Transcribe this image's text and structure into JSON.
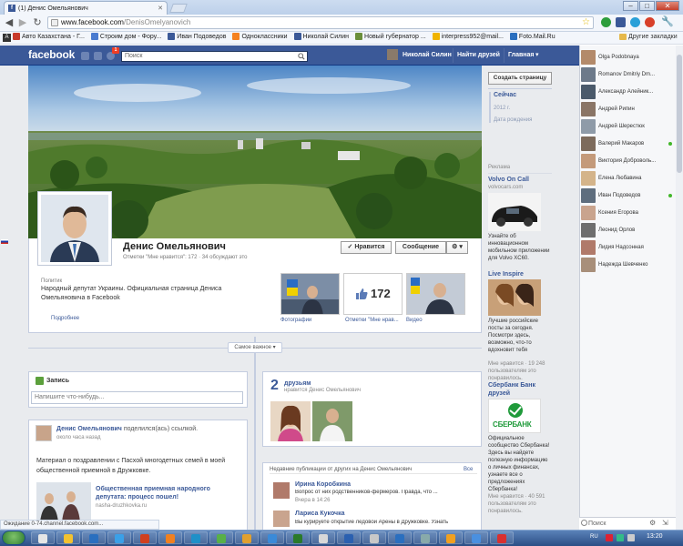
{
  "browser": {
    "tab_title": "(1) Денис Омельянович",
    "favicon_letter": "f",
    "url_host": "www.facebook.com",
    "url_path": "/DenisOmelyanovich",
    "min_label": "–",
    "max_label": "□",
    "close_label": "✕",
    "bookmarks": [
      {
        "label": "Авто Казахстана - Г...",
        "color": "#c8392b"
      },
      {
        "label": "Строим дом - Фору...",
        "color": "#4a7bd0"
      },
      {
        "label": "Иван Подоведов",
        "color": "#3b5998"
      },
      {
        "label": "Одноклассники",
        "color": "#f58220"
      },
      {
        "label": "Николай Силин",
        "color": "#3b5998"
      },
      {
        "label": "Новый губернатор ...",
        "color": "#6a8f3a"
      },
      {
        "label": "interpress952@mail...",
        "color": "#f0b400"
      },
      {
        "label": "Foto.Mail.Ru",
        "color": "#2a6fbf"
      }
    ],
    "other_bookmarks": "Другие закладки",
    "status_text": "Ожидание 0-74.channel.facebook.com..."
  },
  "fb": {
    "logo": "facebook",
    "search_placeholder": "Поиск",
    "notif_count": "1",
    "user_name": "Николай Силин",
    "nav_find_friends": "Найти друзей",
    "nav_home": "Главная",
    "name": "Денис Омельянович",
    "likes_line": "Отметки \"Мне нравится\": 172 · 34 обсуждают это",
    "like_button": "✓ Нравится",
    "message_button": "Сообщение",
    "settings_button": "⚙ ▾",
    "category": "Политик",
    "about": "Народный депутат Украины. Официальная страница Дениса Омельяновича в Facebook",
    "more_link": "Подробнее",
    "thumbs": [
      {
        "label": "Фотографии"
      },
      {
        "label": "Отметки \"Мне нрав..."
      },
      {
        "label": "Видео"
      }
    ],
    "like_count": "172",
    "create_page": "Создать страницу",
    "timeline_nav": [
      {
        "label": "Сейчас",
        "active": true
      },
      {
        "label": "2012 г.",
        "active": false
      },
      {
        "label": "Дата рождения",
        "active": false
      }
    ],
    "timeline_select": "Самое важное ▾",
    "composer_label": "Запись",
    "composer_placeholder": "Напишите что-нибудь...",
    "post": {
      "author": "Денис Омельянович",
      "action": "поделился(ась) ссылкой.",
      "time": "около часа назад",
      "text": "Материал о поздравлении с Пасхой многодетных семей в моей общественной приемной в Дружковке.",
      "link_title": "Общественная приемная народного депутата: процесс пошел!",
      "link_host": "nasha-druzhkovka.ru"
    },
    "friends": {
      "count": "2",
      "label": "друзьям",
      "sub": "нравится Денис Омельянович"
    },
    "recent": {
      "title": "Недавние публикации от других на Денис Омельянович",
      "all": "Все",
      "items": [
        {
          "author": "Ирина Коробкина",
          "text": "Вопрос от них родственников-фермеров. Правда, что ...",
          "time": "Вчера в 14:26"
        },
        {
          "author": "Лариса Кукочка",
          "text": "Вы курируете открытие ледовой Арены в Дружковке. Узнать"
        }
      ]
    },
    "ads": {
      "header": "Реклама",
      "items": [
        {
          "title": "Volvo On Call",
          "host": "volvocars.com",
          "text": "Узнайте об инновационном мобильном приложении для Volvo XC60."
        },
        {
          "title": "Live Inspire",
          "text": "Лучшие российские посты за сегодня. Посмотри здесь, возможно, что-то вдохновит тебя",
          "likes": "Мне нравится · 19 248 пользователям это понравилось."
        },
        {
          "title": "Сбербанк Банк друзей",
          "text": "Официальное сообщество Сбербанка! Здесь вы найдете полезную информацию о личных финансах, узнаете все о предложениях Сбербанка!",
          "likes": "Мне нравится · 40 591 пользователям это понравилось.",
          "logo_text": "СБЕРБАНК"
        }
      ]
    }
  },
  "chat": {
    "contacts": [
      {
        "name": "Olga Podobnaya",
        "online": false,
        "color": "#b38a6a"
      },
      {
        "name": "Romanov Dmitriy Dm...",
        "online": false,
        "color": "#6d7a8a"
      },
      {
        "name": "Александр Алейник...",
        "online": false,
        "color": "#4b5a6b"
      },
      {
        "name": "Андрей Рипин",
        "online": false,
        "color": "#8a7566"
      },
      {
        "name": "Андрей Шерестюк",
        "online": false,
        "color": "#8f9ba8"
      },
      {
        "name": "Валерий Макаров",
        "online": true,
        "color": "#7d6b5c"
      },
      {
        "name": "Виктория Доброволь...",
        "online": false,
        "color": "#c49a7a"
      },
      {
        "name": "Елена Любавина",
        "online": false,
        "color": "#d4b48a"
      },
      {
        "name": "Иван Подоведов",
        "online": true,
        "color": "#5f6e7e"
      },
      {
        "name": "Ксения Егорова",
        "online": false,
        "color": "#c9a48e"
      },
      {
        "name": "Леонид Орлов",
        "online": false,
        "color": "#6e6e6e"
      },
      {
        "name": "Лидия Надсонная",
        "online": false,
        "color": "#b07a6a"
      },
      {
        "name": "Надежда Шевченко",
        "online": false,
        "color": "#a88f7a"
      }
    ],
    "search_placeholder": "Поиск"
  },
  "taskbar": {
    "lang": "RU",
    "clock": "13:20"
  }
}
